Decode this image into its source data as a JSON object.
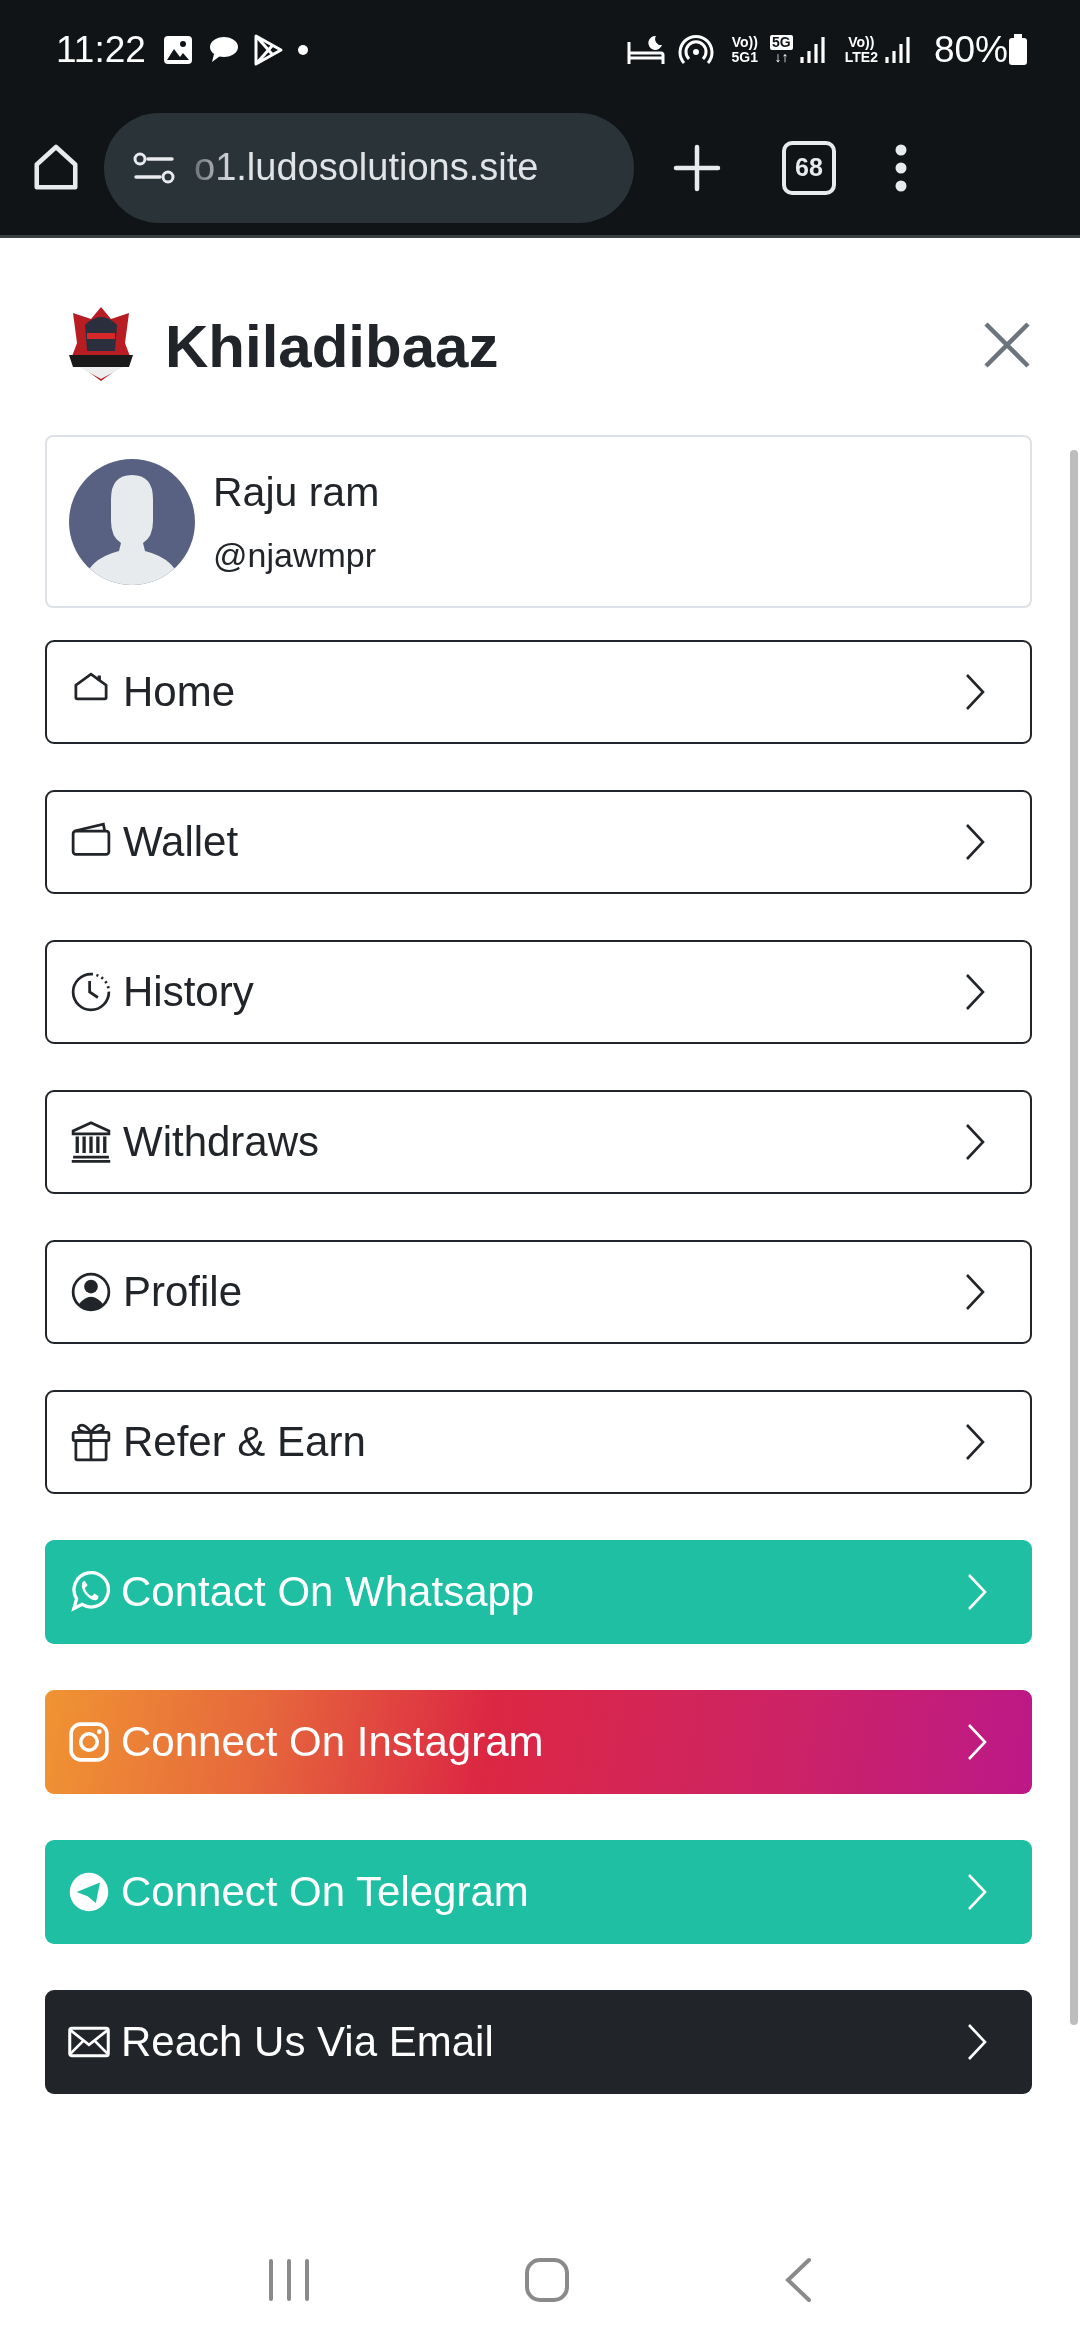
{
  "status_bar": {
    "time": "11:22",
    "network_labels": [
      {
        "top": "Vo))",
        "bottom": "5G1"
      },
      {
        "top": "5G",
        "bottom": "↓↑"
      },
      {
        "top": "Vo))",
        "bottom": "LTE2"
      }
    ],
    "battery": "80%"
  },
  "browser": {
    "url": "o1.ludosolutions.site",
    "tab_count": "68"
  },
  "header": {
    "title": "Khiladibaaz"
  },
  "profile": {
    "name": "Raju ram",
    "handle": "@njawmpr"
  },
  "menu": [
    {
      "kind": "home",
      "label": "Home"
    },
    {
      "kind": "wallet",
      "label": "Wallet"
    },
    {
      "kind": "history",
      "label": "History"
    },
    {
      "kind": "withdraws",
      "label": "Withdraws"
    },
    {
      "kind": "profile",
      "label": "Profile"
    },
    {
      "kind": "refer",
      "label": "Refer & Earn"
    },
    {
      "kind": "whatsapp",
      "label": "Contact On Whatsapp"
    },
    {
      "kind": "instagram",
      "label": "Connect On Instagram"
    },
    {
      "kind": "telegram",
      "label": "Connect On Telegram"
    },
    {
      "kind": "email",
      "label": "Reach Us Via Email"
    }
  ]
}
